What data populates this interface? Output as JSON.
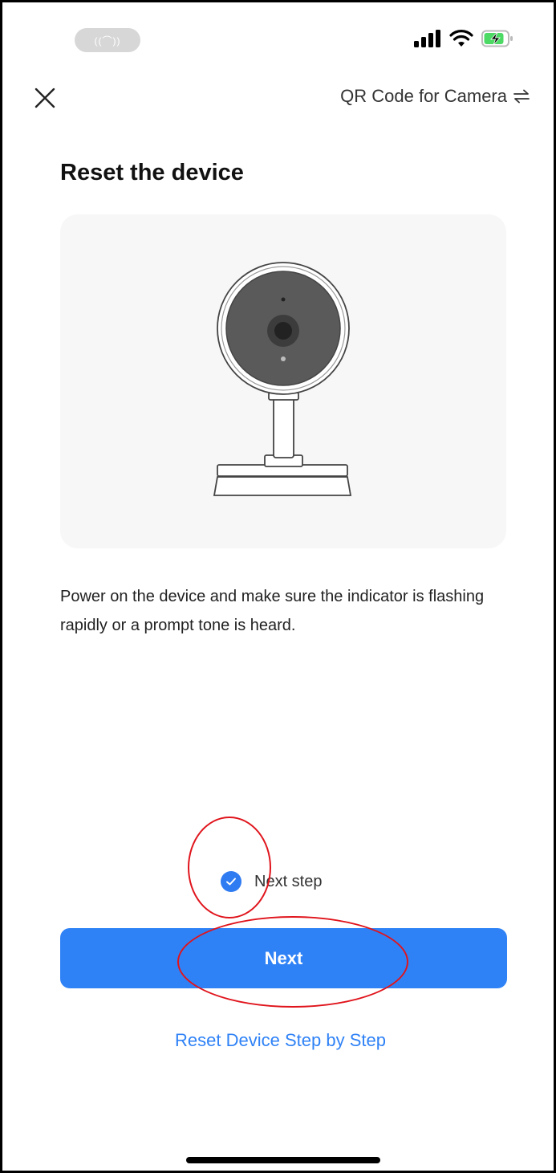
{
  "status_bar": {
    "call_indicator": "((⌒))",
    "icons": [
      "signal-icon",
      "wifi-icon",
      "battery-charging-icon"
    ],
    "battery_color": "#4cd964"
  },
  "nav": {
    "close_icon": "close-icon",
    "mode_switch_label": "QR Code for Camera",
    "mode_switch_icon": "swap-arrows-icon"
  },
  "page": {
    "title": "Reset the device",
    "illustration": "camera-illustration",
    "instruction": "Power on the device and make sure the indicator is flashing rapidly or a prompt tone is heard."
  },
  "confirm": {
    "checked": true,
    "label": "Next step"
  },
  "actions": {
    "next_label": "Next",
    "reset_link": "Reset Device Step by Step"
  },
  "colors": {
    "accent": "#2f82f6",
    "check": "#2f7bf1",
    "annotation": "#e0141c"
  }
}
